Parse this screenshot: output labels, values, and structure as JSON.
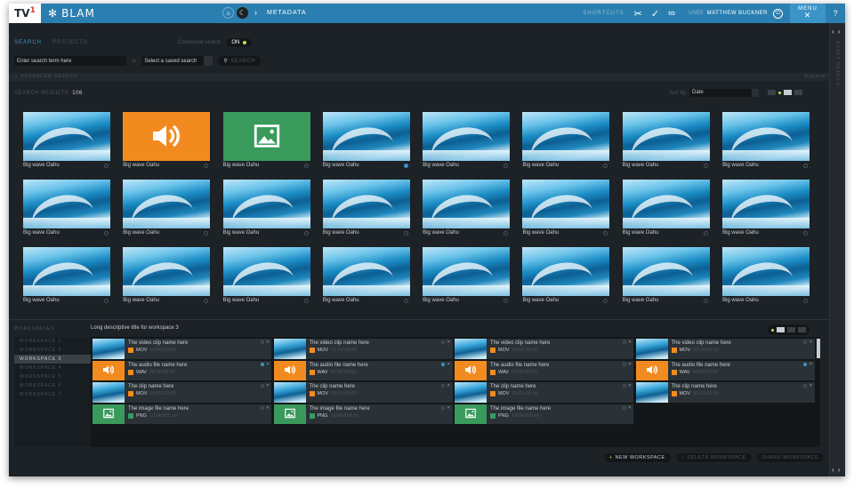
{
  "header": {
    "logo_text": "TV",
    "logo_sup": "1",
    "app_name": "BLAM",
    "breadcrumb": "METADATA",
    "shortcuts_label": "SHORTCUTS",
    "user_label": "USER",
    "user_name": "MATTHEW BUCKNER",
    "menu_label": "MENU",
    "help": "?"
  },
  "search": {
    "tab_search": "SEARCH",
    "tab_projects": "PROJECTS",
    "contextual_label": "Contextual search",
    "contextual_value": "ON",
    "placeholder": "Enter search term here",
    "or": "or",
    "saved_placeholder": "Select a saved search",
    "button": "SEARCH",
    "advanced": "ADVANCED SEARCH",
    "expand": "Expand",
    "results_label": "SEARCH RESULTS:",
    "results_count": "106",
    "sort_label": "Sort by",
    "sort_value": "Date"
  },
  "assets": [
    {
      "name": "Big wave Oahu",
      "kind": "wave",
      "selected": false
    },
    {
      "name": "Big wave Oahu",
      "kind": "audio",
      "selected": false
    },
    {
      "name": "Big wave Oahu",
      "kind": "image",
      "selected": false
    },
    {
      "name": "Big wave Oahu",
      "kind": "wave",
      "selected": true
    },
    {
      "name": "Big wave Oahu",
      "kind": "wave",
      "selected": false
    },
    {
      "name": "Big wave Oahu",
      "kind": "wave",
      "selected": false
    },
    {
      "name": "Big wave Oahu",
      "kind": "wave",
      "selected": false
    },
    {
      "name": "Big wave Oahu",
      "kind": "wave",
      "selected": false
    },
    {
      "name": "Big wave Oahu",
      "kind": "wave",
      "selected": false
    },
    {
      "name": "Big wave Oahu",
      "kind": "wave",
      "selected": false
    },
    {
      "name": "Big wave Oahu",
      "kind": "wave",
      "selected": false
    },
    {
      "name": "Big wave Oahu",
      "kind": "wave",
      "selected": false
    },
    {
      "name": "Big wave Oahu",
      "kind": "wave",
      "selected": false
    },
    {
      "name": "Big wave Oahu",
      "kind": "wave",
      "selected": false
    },
    {
      "name": "Big wave Oahu",
      "kind": "wave",
      "selected": false
    },
    {
      "name": "Big wave Oahu",
      "kind": "wave",
      "selected": false
    },
    {
      "name": "Big wave Oahu",
      "kind": "wave",
      "selected": false
    },
    {
      "name": "Big wave Oahu",
      "kind": "wave",
      "selected": false
    },
    {
      "name": "Big wave Oahu",
      "kind": "wave",
      "selected": false
    },
    {
      "name": "Big wave Oahu",
      "kind": "wave",
      "selected": false
    },
    {
      "name": "Big wave Oahu",
      "kind": "wave",
      "selected": false
    },
    {
      "name": "Big wave Oahu",
      "kind": "wave",
      "selected": false
    },
    {
      "name": "Big wave Oahu",
      "kind": "wave",
      "selected": false
    },
    {
      "name": "Big wave Oahu",
      "kind": "wave",
      "selected": false
    }
  ],
  "workspace": {
    "label": "WORKSPACES",
    "title": "Long descriptive title for workspace 3",
    "list": [
      "WORKSPACE 1",
      "WORKSPACE 2",
      "WORKSPACE 3",
      "WORKSPACE 4",
      "WORKSPACE 5",
      "WORKSPACE 6",
      "WORKSPACE 7"
    ],
    "active_index": 2,
    "items": [
      {
        "title": "The video clip name here",
        "kind": "wave",
        "format": "MOV",
        "duration": "00:00:00:00",
        "selected": false
      },
      {
        "title": "The video clip name here",
        "kind": "wave",
        "format": "MOV",
        "duration": "00:00:00:00",
        "selected": false
      },
      {
        "title": "The video clip name here",
        "kind": "wave",
        "format": "MOV",
        "duration": "00:00:00:00",
        "selected": false
      },
      {
        "title": "The video clip name here",
        "kind": "wave",
        "format": "MOV",
        "duration": "00:00:00:00",
        "selected": false
      },
      {
        "title": "The audio file name here",
        "kind": "audio",
        "format": "WAV",
        "duration": "00:00:00:00",
        "selected": true
      },
      {
        "title": "The audio file name here",
        "kind": "audio",
        "format": "WAV",
        "duration": "00:00:00:00",
        "selected": true
      },
      {
        "title": "The audio file name here",
        "kind": "audio",
        "format": "WAV",
        "duration": "00:00:00:00",
        "selected": false
      },
      {
        "title": "The audio file name here",
        "kind": "audio",
        "format": "WAV",
        "duration": "00:00:00:00",
        "selected": true
      },
      {
        "title": "The clip name here",
        "kind": "wave",
        "format": "MOV",
        "duration": "00:00:00:00",
        "selected": false
      },
      {
        "title": "The clip name here",
        "kind": "wave",
        "format": "MOV",
        "duration": "00:00:00:00",
        "selected": false
      },
      {
        "title": "The clip name here",
        "kind": "wave",
        "format": "MOV",
        "duration": "00:00:00:00",
        "selected": false
      },
      {
        "title": "The clip name here",
        "kind": "wave",
        "format": "MOV",
        "duration": "00:00:00:00",
        "selected": false
      },
      {
        "title": "The image file name here",
        "kind": "image",
        "format": "PNG",
        "duration": "1024x800 px",
        "selected": false
      },
      {
        "title": "The image file name here",
        "kind": "image",
        "format": "PNG",
        "duration": "1024x800 px",
        "selected": false
      },
      {
        "title": "The image file name here",
        "kind": "image",
        "format": "PNG",
        "duration": "1024x800 px",
        "selected": false
      }
    ]
  },
  "footer": {
    "new_workspace": "NEW WORKSPACE",
    "delete_workspace": "DELETE WORKSPACE",
    "share_workspace": "SHARE WORKSPACE"
  },
  "side": {
    "collapse": "‹ ‹",
    "vertical_label": "ASSET DETAILS"
  },
  "colors": {
    "accent": "#2b7fb0",
    "audio": "#f28b1f",
    "image": "#3a9a5c",
    "toggle_on": "#c6e24a"
  }
}
